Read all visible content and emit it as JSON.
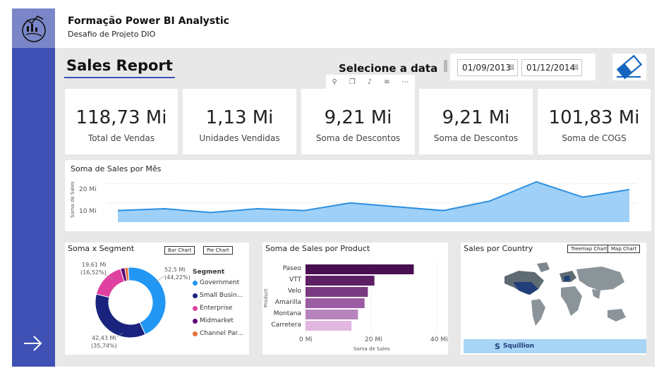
{
  "header": {
    "title": "Formação Power BI Analystic",
    "subtitle": "Desafio de Projeto DIO"
  },
  "report": {
    "title": "Sales Report",
    "date_label": "Selecione a data",
    "date_start": "01/09/2013",
    "date_end": "01/12/2014"
  },
  "toolbar_icons": [
    "pin-icon",
    "copy-icon",
    "bell-icon",
    "filter-icon",
    "more-icon"
  ],
  "kpis": [
    {
      "value": "118,73 Mi",
      "label": "Total de Vendas"
    },
    {
      "value": "1,13 Mi",
      "label": "Unidades Vendidas"
    },
    {
      "value": "9,21 Mi",
      "label": "Soma de Descontos"
    },
    {
      "value": "9,21 Mi",
      "label": "Soma de Descontos"
    },
    {
      "value": "101,83 Mi",
      "label": "Soma de COGS"
    }
  ],
  "line_panel": {
    "title": "Soma de Sales por Mês",
    "ylabel": "Soma de Sales",
    "yticks": [
      "20 Mi",
      "10 Mi"
    ]
  },
  "segment_panel": {
    "title": "Soma x Segment",
    "btn_bar": "Bar Chart",
    "btn_pie": "Pie Chart",
    "legend_title": "Segment",
    "label_top_left": "19,61 Mi",
    "label_top_left_pct": "(16,52%)",
    "label_right": "52,5 Mi",
    "label_right_pct": "(44,22%)",
    "label_bottom": "42,43 Mi",
    "label_bottom_pct": "(35,74%)"
  },
  "product_panel": {
    "title": "Soma de Sales por Product",
    "ylabel": "Product",
    "xlabel": "Soma de Sales",
    "xticks": [
      "0 Mi",
      "20 Mi",
      "40 Mi"
    ]
  },
  "country_panel": {
    "title": "Sales por Country",
    "btn_treemap": "Treemap Chart",
    "btn_map": "Map Chart",
    "brand": "Squillion"
  },
  "chart_data": [
    {
      "type": "area",
      "title": "Soma de Sales por Mês",
      "ylabel": "Soma de Sales",
      "x": [
        1,
        2,
        3,
        4,
        5,
        6,
        7,
        8,
        9,
        10,
        11,
        12,
        13,
        14,
        15,
        16
      ],
      "values": [
        6,
        7,
        5,
        7,
        6,
        10,
        8,
        6,
        11,
        21,
        13,
        17
      ],
      "ylim": [
        0,
        25
      ]
    },
    {
      "type": "pie",
      "title": "Soma x Segment",
      "series": [
        {
          "name": "Government",
          "value": 52.5,
          "color": "#2196f3"
        },
        {
          "name": "Small Busin...",
          "value": 42.43,
          "color": "#1a237e"
        },
        {
          "name": "Enterprise",
          "value": 19.61,
          "color": "#e040a0"
        },
        {
          "name": "Midmarket",
          "value": 2.4,
          "color": "#5e0a78"
        },
        {
          "name": "Channel Par...",
          "value": 1.8,
          "color": "#e8703a"
        }
      ]
    },
    {
      "type": "bar",
      "title": "Soma de Sales por Product",
      "categories": [
        "Paseo",
        "VTT",
        "Velo",
        "Amarilla",
        "Montana",
        "Carretera"
      ],
      "values": [
        33,
        21,
        19,
        18,
        16,
        14
      ],
      "xlim": [
        0,
        40
      ],
      "colors": [
        "#4a0f52",
        "#5e1f66",
        "#7a3a82",
        "#9a5ca2",
        "#b783bd",
        "#e2b7e0"
      ]
    }
  ]
}
